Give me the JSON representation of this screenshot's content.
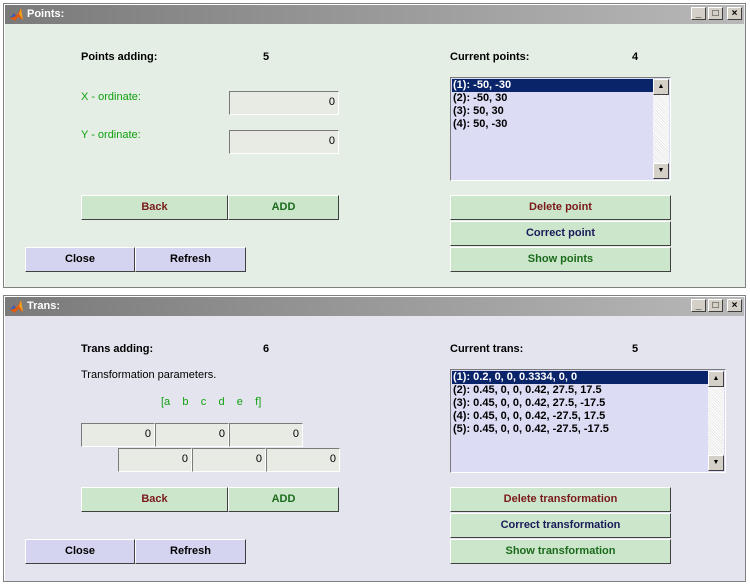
{
  "points_window": {
    "title": "Points:",
    "points_adding_label": "Points adding:",
    "points_adding_value": "5",
    "x_label": "X - ordinate:",
    "x_value": "0",
    "y_label": "Y - ordinate:",
    "y_value": "0",
    "current_label": "Current points:",
    "current_value": "4",
    "list": [
      "(1):  -50, -30",
      "(2):  -50, 30",
      "(3):  50, 30",
      "(4):  50, -30"
    ],
    "buttons": {
      "back": "Back",
      "add": "ADD",
      "close": "Close",
      "refresh": "Refresh",
      "delete": "Delete point",
      "correct": "Correct point",
      "show": "Show points"
    }
  },
  "trans_window": {
    "title": "Trans:",
    "trans_adding_label": "Trans adding:",
    "trans_adding_value": "6",
    "params_label": "Transformation parameters.",
    "param_names": "[a    b    c    d    e    f]",
    "params_row1": [
      "0",
      "0",
      "0"
    ],
    "params_row2": [
      "0",
      "0",
      "0"
    ],
    "current_label": "Current trans:",
    "current_value": "5",
    "list": [
      "(1):  0.2, 0, 0, 0.3334, 0, 0",
      "(2):  0.45, 0, 0, 0.42, 27.5, 17.5",
      "(3):  0.45, 0, 0, 0.42, 27.5, -17.5",
      "(4):  0.45, 0, 0, 0.42, -27.5, 17.5",
      "(5):  0.45, 0, 0, 0.42, -27.5, -17.5"
    ],
    "buttons": {
      "back": "Back",
      "add": "ADD",
      "close": "Close",
      "refresh": "Refresh",
      "delete": "Delete transformation",
      "correct": "Correct transformation",
      "show": "Show transformation"
    }
  },
  "window_controls": {
    "minimize": "_",
    "maximize": "□",
    "close": "×"
  },
  "icons": {
    "app": "matlab-logo-icon",
    "scroll_up": "arrow-up-icon",
    "scroll_down": "arrow-down-icon"
  }
}
